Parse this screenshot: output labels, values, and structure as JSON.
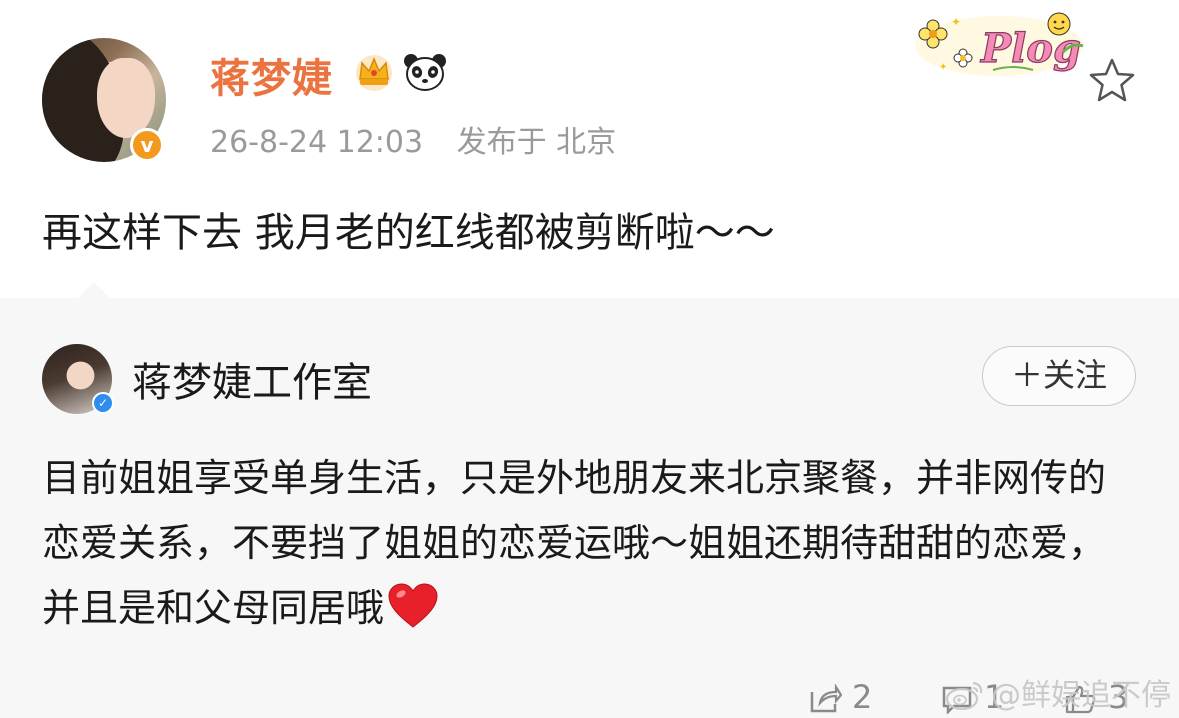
{
  "post": {
    "username": "蒋梦婕",
    "verified_badge": "v",
    "timestamp": "26-8-24 12:03",
    "location": "发布于 北京",
    "sticker_text": "Plog",
    "text": "再这样下去 我月老的红线都被剪断啦～～",
    "icons": [
      "crown-icon",
      "panda-icon",
      "star-icon"
    ]
  },
  "repost": {
    "author": "蒋梦婕工作室",
    "follow_label": "＋关注",
    "text": "目前姐姐享受单身生活，只是外地朋友来北京聚餐，并非网传的恋爱关系，不要挡了姐姐的恋爱运哦～姐姐还期待甜甜的恋爱，并且是和父母同居哦",
    "emoji": "heart-icon",
    "actions": {
      "share_count": "2",
      "comment_count": "1",
      "like_count": "3"
    }
  },
  "watermark": "@鲜娱追不停",
  "colors": {
    "username": "#eb7340",
    "verified_orange": "#f39a1e",
    "verified_blue": "#2f8cf0",
    "card_bg": "#f7f7f7",
    "meta_gray": "#9a9a9a"
  }
}
